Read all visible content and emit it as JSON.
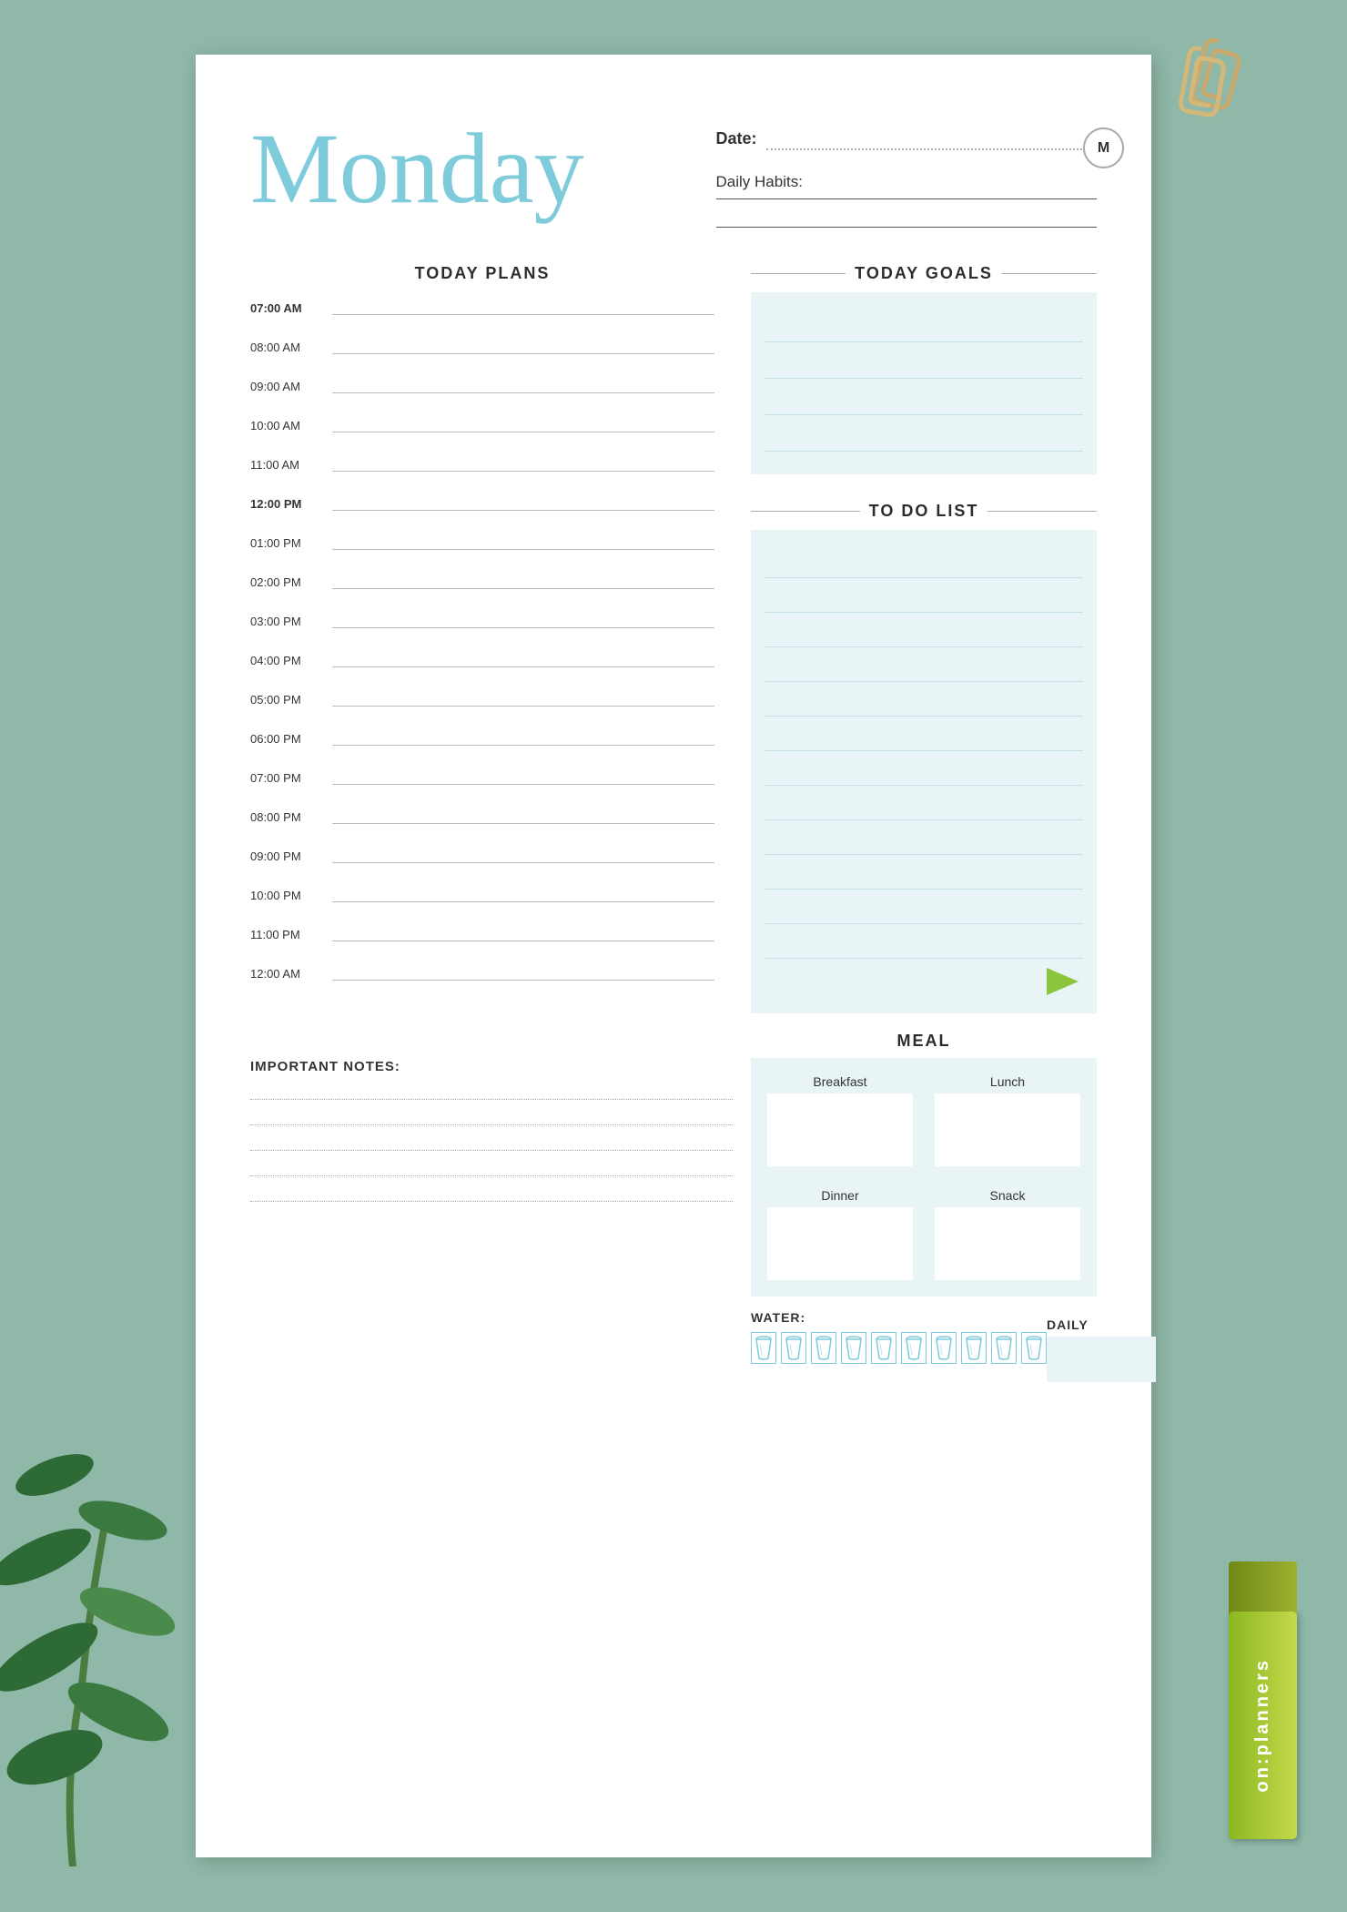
{
  "background_color": "#8fb8a8",
  "paper": {
    "title": "Monday",
    "date_label": "Date:",
    "m_circle": "M",
    "daily_habits_label": "Daily Habits:"
  },
  "today_plans": {
    "section_title": "TODAY PLANS",
    "time_slots": [
      {
        "time": "07:00 AM",
        "bold": true
      },
      {
        "time": "08:00 AM",
        "bold": false
      },
      {
        "time": "09:00 AM",
        "bold": false
      },
      {
        "time": "10:00 AM",
        "bold": false
      },
      {
        "time": "11:00 AM",
        "bold": false
      },
      {
        "time": "12:00 PM",
        "bold": true
      },
      {
        "time": "01:00 PM",
        "bold": false
      },
      {
        "time": "02:00 PM",
        "bold": false
      },
      {
        "time": "03:00 PM",
        "bold": false
      },
      {
        "time": "04:00 PM",
        "bold": false
      },
      {
        "time": "05:00 PM",
        "bold": false
      },
      {
        "time": "06:00 PM",
        "bold": false
      },
      {
        "time": "07:00 PM",
        "bold": false
      },
      {
        "time": "08:00 PM",
        "bold": false
      },
      {
        "time": "09:00 PM",
        "bold": false
      },
      {
        "time": "10:00 PM",
        "bold": false
      },
      {
        "time": "11:00 PM",
        "bold": false
      },
      {
        "time": "12:00 AM",
        "bold": false
      }
    ]
  },
  "today_goals": {
    "section_title": "TODAY GOALS"
  },
  "todo_list": {
    "section_title": "TO DO LIST"
  },
  "meal": {
    "section_title": "MEAL",
    "cells": [
      {
        "label": "Breakfast"
      },
      {
        "label": "Lunch"
      },
      {
        "label": "Dinner"
      },
      {
        "label": "Snack"
      }
    ]
  },
  "water": {
    "label": "WATER:",
    "count": 10
  },
  "daily": {
    "label": "DAILY"
  },
  "important_notes": {
    "label": "IMPORTANT NOTES:"
  },
  "brand": {
    "text": "on:planners"
  }
}
